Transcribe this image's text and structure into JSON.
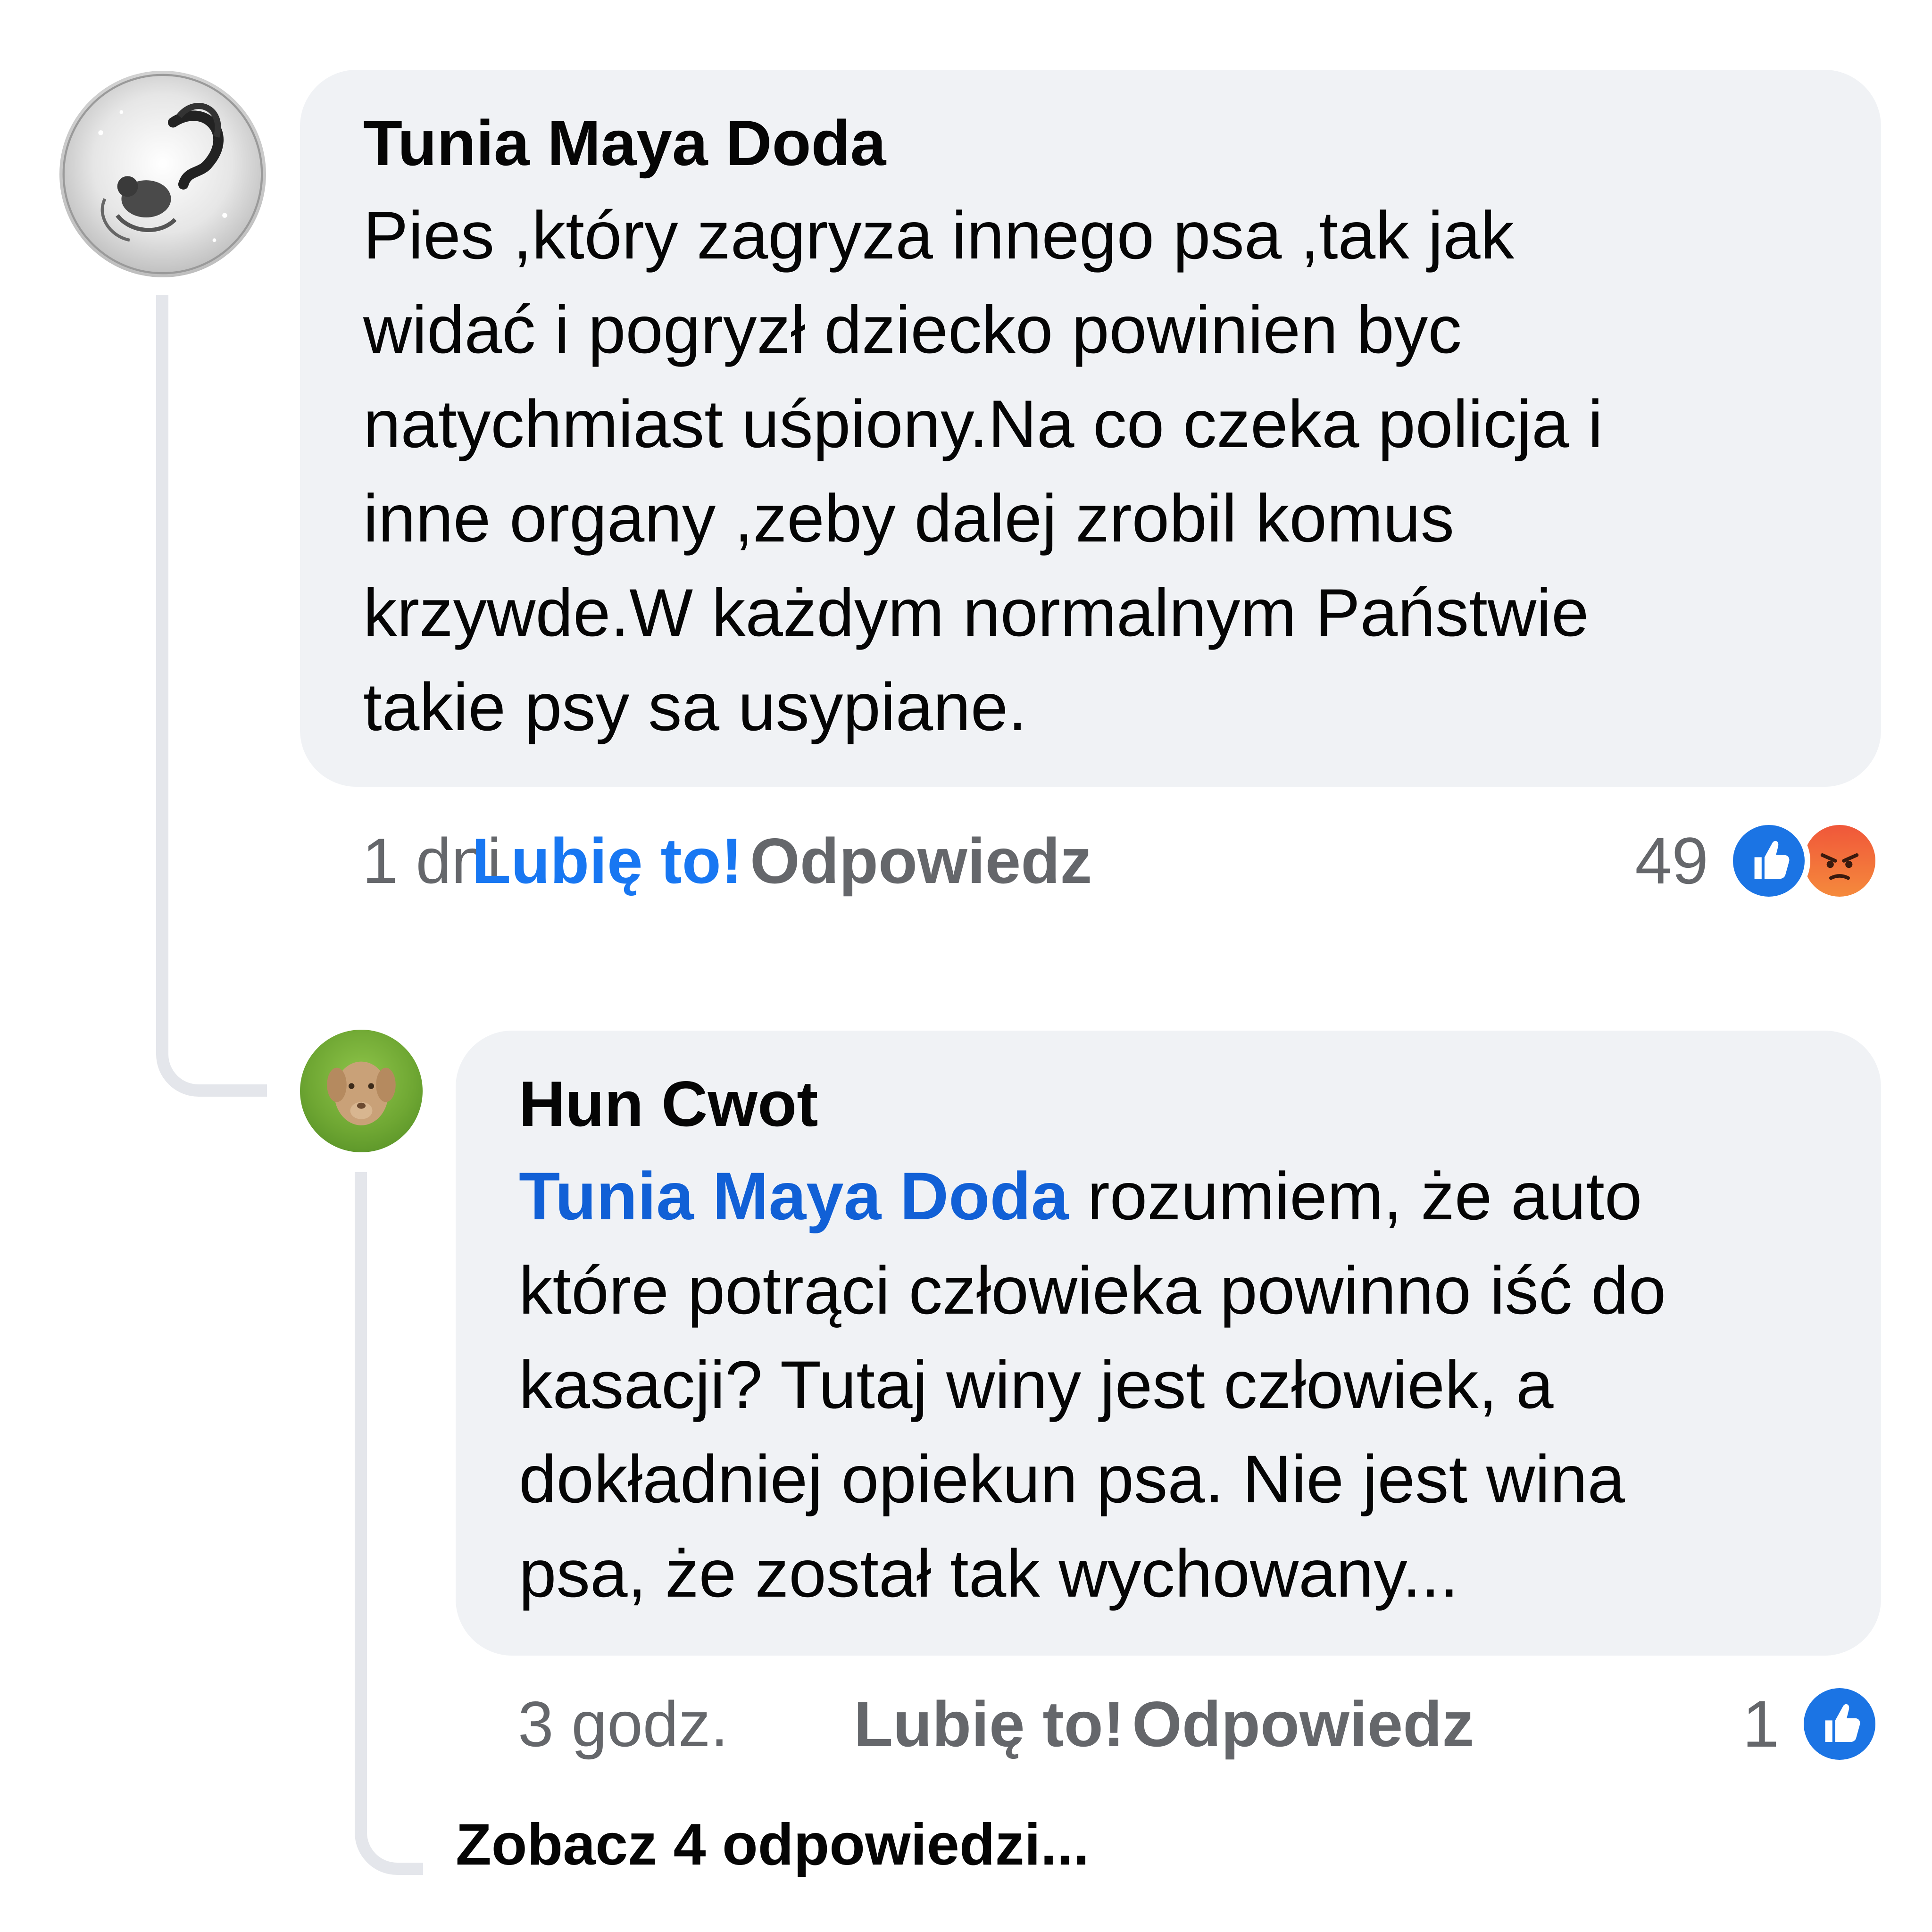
{
  "comments": [
    {
      "author": "Tunia Maya Doda",
      "avatar_icon": "squirrel-illustration-avatar",
      "lines": [
        "Pies ,który zagryza innego psa ,tak jak",
        "widać i pogryzł dziecko powinien byc",
        "natychmiast uśpiony.Na co czeka policja i",
        "inne organy ,zeby dalej zrobil komus",
        "krzywde.W każdym normalnym Państwie",
        "takie psy sa usypiane."
      ],
      "time": "1 dni",
      "like_label": "Lubię to!",
      "like_active": true,
      "reply_label": "Odpowiedz",
      "reaction_count": "49",
      "reactions": [
        "like-icon",
        "angry-icon"
      ]
    },
    {
      "author": "Hun Cwot",
      "avatar_icon": "dog-photo-avatar",
      "mention": "Tunia Maya Doda",
      "first_line_rest": " rozumiem, że auto",
      "lines": [
        "które potrąci człowieka powinno iść do",
        "kasacji? Tutaj winy jest człowiek, a",
        "dokładniej opiekun psa. Nie jest wina",
        "psa, że został tak wychowany..."
      ],
      "time": "3 godz.",
      "like_label": "Lubię to!",
      "like_active": false,
      "reply_label": "Odpowiedz",
      "reaction_count": "1",
      "reactions": [
        "like-icon"
      ]
    }
  ],
  "more_replies_label": "Zobacz 4 odpowiedzi...",
  "colors": {
    "bubble": "#f0f2f5",
    "thread_line": "#e4e6eb",
    "like_blue": "#1877f2",
    "mention_blue": "#1160d6",
    "meta_gray": "#65676b"
  }
}
